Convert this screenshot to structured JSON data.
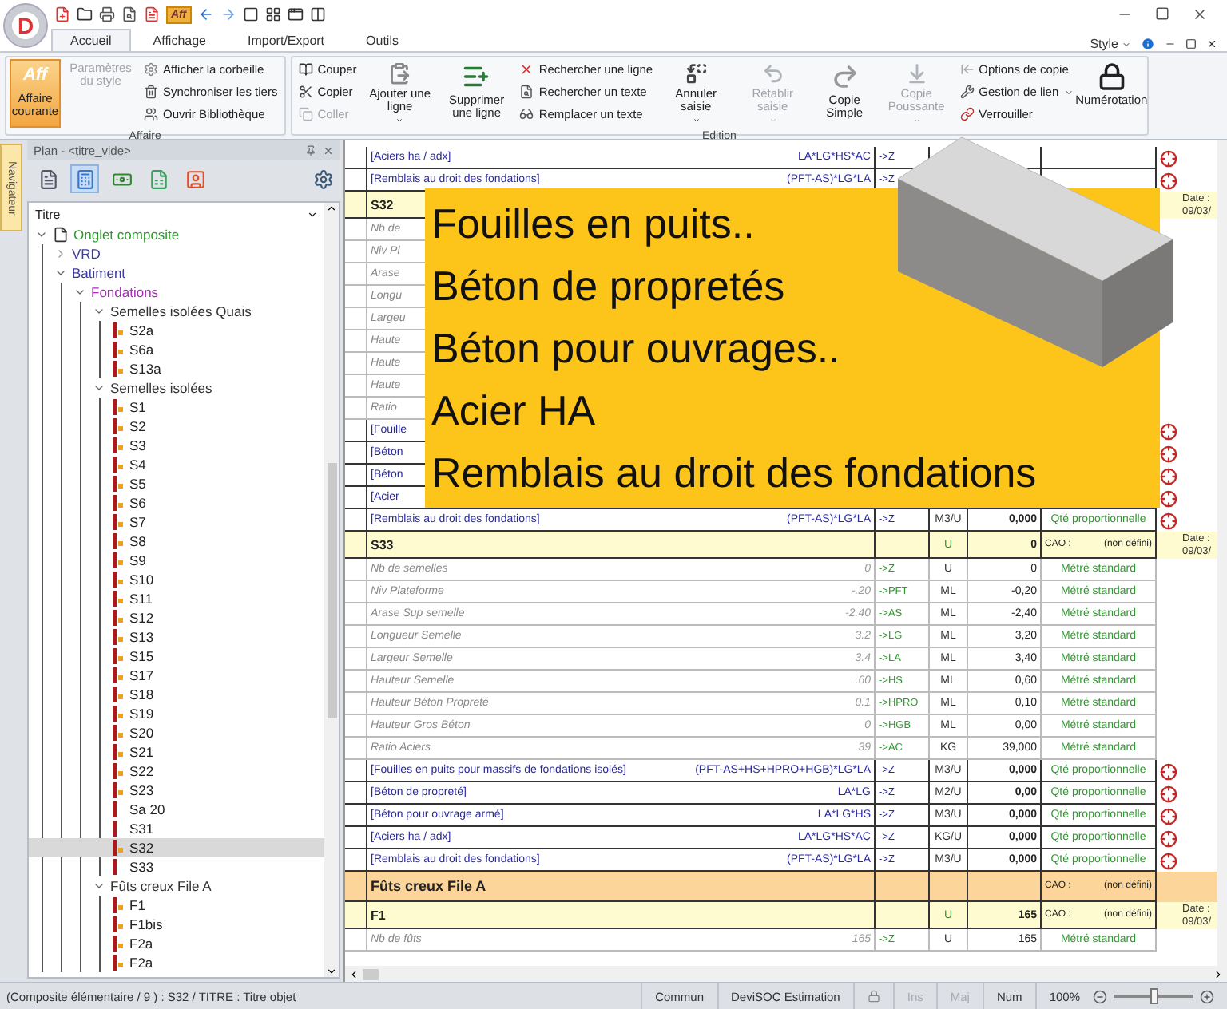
{
  "app_logo": "D",
  "quick_access_label": "Aff",
  "ribbon": {
    "tabs": [
      {
        "label": "Accueil",
        "selected": true
      },
      {
        "label": "Affichage",
        "selected": false
      },
      {
        "label": "Import/Export",
        "selected": false
      },
      {
        "label": "Outils",
        "selected": false
      }
    ],
    "style_menu": "Style",
    "groups": [
      {
        "title": "Affaire",
        "items": [
          {
            "kind": "large",
            "label": "Affaire courante",
            "badge": "Aff",
            "active": true,
            "disabled": false,
            "dropdown": false
          },
          {
            "kind": "large",
            "label": "Paramètres du style",
            "active": false,
            "disabled": true,
            "dropdown": false
          },
          {
            "kind": "stack",
            "buttons": [
              {
                "label": "Afficher la corbeille",
                "disabled": false,
                "dropdown": false
              },
              {
                "label": "Synchroniser les tiers",
                "disabled": false,
                "dropdown": false
              },
              {
                "label": "Ouvrir Bibliothèque",
                "disabled": false,
                "dropdown": false
              }
            ]
          }
        ]
      },
      {
        "title": "Edition",
        "items": [
          {
            "kind": "stack",
            "buttons": [
              {
                "label": "Couper",
                "disabled": false,
                "dropdown": false
              },
              {
                "label": "Copier",
                "disabled": false,
                "dropdown": false
              },
              {
                "label": "Coller",
                "disabled": true,
                "dropdown": false
              }
            ]
          },
          {
            "kind": "large",
            "label": "Ajouter une ligne",
            "active": false,
            "disabled": false,
            "dropdown": true
          },
          {
            "kind": "large",
            "label": "Supprimer une ligne",
            "active": false,
            "disabled": false,
            "dropdown": false
          },
          {
            "kind": "stack",
            "buttons": [
              {
                "label": "Rechercher une ligne",
                "disabled": false,
                "dropdown": false
              },
              {
                "label": "Rechercher un texte",
                "disabled": false,
                "dropdown": false
              },
              {
                "label": "Remplacer un texte",
                "disabled": false,
                "dropdown": false
              }
            ]
          },
          {
            "kind": "large",
            "label": "Annuler saisie",
            "active": false,
            "disabled": false,
            "dropdown": true
          },
          {
            "kind": "large",
            "label": "Rétablir saisie",
            "active": false,
            "disabled": true,
            "dropdown": true
          },
          {
            "kind": "large",
            "label": "Copie Simple",
            "active": false,
            "disabled": false,
            "dropdown": false
          },
          {
            "kind": "large",
            "label": "Copie Poussante",
            "active": false,
            "disabled": true,
            "dropdown": true
          },
          {
            "kind": "stack",
            "buttons": [
              {
                "label": "Options de copie",
                "disabled": false,
                "dropdown": false
              },
              {
                "label": "Gestion de lien",
                "disabled": false,
                "dropdown": true
              },
              {
                "label": "Verrouiller",
                "disabled": false,
                "dropdown": false
              }
            ]
          },
          {
            "kind": "large",
            "label": "Numérotation",
            "active": false,
            "disabled": false,
            "dropdown": false
          }
        ]
      }
    ]
  },
  "navigator": {
    "tab": "Navigateur",
    "title": "Plan - <titre_vide>",
    "toolbar": [
      {
        "selected": false
      },
      {
        "selected": true
      },
      {
        "selected": false
      },
      {
        "selected": false
      },
      {
        "selected": false
      }
    ],
    "tree": {
      "header": "Titre",
      "items": [
        {
          "label": "Onglet composite",
          "kind": "document",
          "color": "#2e9a2e",
          "expanded": true,
          "children": [
            {
              "label": "VRD",
              "kind": "folder",
              "color": "#3a3aa0",
              "expanded": false
            },
            {
              "label": "Batiment",
              "kind": "folder",
              "color": "#3a3aa0",
              "expanded": true,
              "children": [
                {
                  "label": "Fondations",
                  "kind": "folder",
                  "color": "#a030b0",
                  "expanded": true,
                  "children": [
                    {
                      "label": "Semelles isolées Quais",
                      "kind": "folder",
                      "color": "#333333",
                      "expanded": true,
                      "children": [
                        {
                          "label": "S2a",
                          "kind": "leaf",
                          "flagged": true,
                          "selected": false
                        },
                        {
                          "label": "S6a",
                          "kind": "leaf",
                          "flagged": true,
                          "selected": false
                        },
                        {
                          "label": "S13a",
                          "kind": "leaf",
                          "flagged": true,
                          "selected": false
                        }
                      ]
                    },
                    {
                      "label": "Semelles isolées",
                      "kind": "folder",
                      "color": "#333333",
                      "expanded": true,
                      "children": [
                        {
                          "label": "S1",
                          "kind": "leaf",
                          "flagged": true,
                          "selected": false
                        },
                        {
                          "label": "S2",
                          "kind": "leaf",
                          "flagged": true,
                          "selected": false
                        },
                        {
                          "label": "S3",
                          "kind": "leaf",
                          "flagged": true,
                          "selected": false
                        },
                        {
                          "label": "S4",
                          "kind": "leaf",
                          "flagged": true,
                          "selected": false
                        },
                        {
                          "label": "S5",
                          "kind": "leaf",
                          "flagged": true,
                          "selected": false
                        },
                        {
                          "label": "S6",
                          "kind": "leaf",
                          "flagged": true,
                          "selected": false
                        },
                        {
                          "label": "S7",
                          "kind": "leaf",
                          "flagged": true,
                          "selected": false
                        },
                        {
                          "label": "S8",
                          "kind": "leaf",
                          "flagged": true,
                          "selected": false
                        },
                        {
                          "label": "S9",
                          "kind": "leaf",
                          "flagged": true,
                          "selected": false
                        },
                        {
                          "label": "S10",
                          "kind": "leaf",
                          "flagged": true,
                          "selected": false
                        },
                        {
                          "label": "S11",
                          "kind": "leaf",
                          "flagged": true,
                          "selected": false
                        },
                        {
                          "label": "S12",
                          "kind": "leaf",
                          "flagged": true,
                          "selected": false
                        },
                        {
                          "label": "S13",
                          "kind": "leaf",
                          "flagged": true,
                          "selected": false
                        },
                        {
                          "label": "S15",
                          "kind": "leaf",
                          "flagged": true,
                          "selected": false
                        },
                        {
                          "label": "S17",
                          "kind": "leaf",
                          "flagged": true,
                          "selected": false
                        },
                        {
                          "label": "S18",
                          "kind": "leaf",
                          "flagged": true,
                          "selected": false
                        },
                        {
                          "label": "S19",
                          "kind": "leaf",
                          "flagged": true,
                          "selected": false
                        },
                        {
                          "label": "S20",
                          "kind": "leaf",
                          "flagged": true,
                          "selected": false
                        },
                        {
                          "label": "S21",
                          "kind": "leaf",
                          "flagged": true,
                          "selected": false
                        },
                        {
                          "label": "S22",
                          "kind": "leaf",
                          "flagged": true,
                          "selected": false
                        },
                        {
                          "label": "S23",
                          "kind": "leaf",
                          "flagged": true,
                          "selected": false
                        },
                        {
                          "label": "Sa 20",
                          "kind": "leaf",
                          "flagged": false,
                          "selected": false
                        },
                        {
                          "label": "S31",
                          "kind": "leaf",
                          "flagged": false,
                          "selected": false
                        },
                        {
                          "label": "S32",
                          "kind": "leaf",
                          "flagged": true,
                          "selected": true
                        },
                        {
                          "label": "S33",
                          "kind": "leaf",
                          "flagged": false,
                          "selected": false
                        }
                      ]
                    },
                    {
                      "label": "Fûts creux  File A",
                      "kind": "folder",
                      "color": "#333333",
                      "expanded": true,
                      "children": [
                        {
                          "label": "F1",
                          "kind": "leaf",
                          "flagged": true,
                          "selected": false
                        },
                        {
                          "label": "F1bis",
                          "kind": "leaf",
                          "flagged": true,
                          "selected": false
                        },
                        {
                          "label": "F2a",
                          "kind": "leaf",
                          "flagged": true,
                          "selected": false
                        },
                        {
                          "label": "F2a",
                          "kind": "leaf",
                          "flagged": true,
                          "selected": false
                        }
                      ]
                    }
                  ]
                }
              ]
            }
          ]
        }
      ]
    }
  },
  "table": {
    "rows": [
      {
        "kind": "formula",
        "label": "[Aciers ha / adx]",
        "formula": "LA*LG*HS*AC",
        "var": "->Z",
        "marker": true
      },
      {
        "kind": "formula",
        "label": "[Remblais au droit des fondations]",
        "formula": "(PFT-AS)*LG*LA",
        "var": "->Z",
        "marker": true
      },
      {
        "kind": "item",
        "label": "S32",
        "note": [
          "Date :",
          "09/03/"
        ]
      },
      {
        "kind": "measure",
        "label": "Nb de"
      },
      {
        "kind": "measure",
        "label": "Niv Pl"
      },
      {
        "kind": "measure",
        "label": "Arase"
      },
      {
        "kind": "measure",
        "label": "Longu"
      },
      {
        "kind": "measure",
        "label": "Largeu"
      },
      {
        "kind": "measure",
        "label": "Haute"
      },
      {
        "kind": "measure",
        "label": "Haute"
      },
      {
        "kind": "measure",
        "label": "Haute"
      },
      {
        "kind": "measure",
        "label": "Ratio"
      },
      {
        "kind": "formula",
        "label": "[Fouille",
        "marker": true
      },
      {
        "kind": "formula",
        "label": "[Béton",
        "marker": true
      },
      {
        "kind": "formula",
        "label": "[Béton",
        "marker": true
      },
      {
        "kind": "formula",
        "label": "[Acier",
        "marker": true
      },
      {
        "kind": "formula",
        "label": "[Remblais au droit des fondations]",
        "formula": "(PFT-AS)*LG*LA",
        "var": "->Z",
        "unit": "M3/U",
        "qty": "0,000",
        "type": "Qté proportionnelle",
        "marker": true
      },
      {
        "kind": "item",
        "label": "S33",
        "unit": "U",
        "qty": "0",
        "cao": "CAO :",
        "cao_value": "(non défini)",
        "note": [
          "Date :",
          "09/03/"
        ]
      },
      {
        "kind": "measure",
        "label": "Nb de semelles",
        "formula": "0",
        "var": "->Z",
        "unit": "U",
        "qty": "0",
        "type": "Métré standard"
      },
      {
        "kind": "measure",
        "label": "Niv Plateforme",
        "formula": "-.20",
        "var": "->PFT",
        "unit": "ML",
        "qty": "-0,20",
        "type": "Métré standard"
      },
      {
        "kind": "measure",
        "label": "Arase Sup semelle",
        "formula": "-2.40",
        "var": "->AS",
        "unit": "ML",
        "qty": "-2,40",
        "type": "Métré standard"
      },
      {
        "kind": "measure",
        "label": "Longueur Semelle",
        "formula": "3.2",
        "var": "->LG",
        "unit": "ML",
        "qty": "3,20",
        "type": "Métré standard"
      },
      {
        "kind": "measure",
        "label": "Largeur Semelle",
        "formula": "3.4",
        "var": "->LA",
        "unit": "ML",
        "qty": "3,40",
        "type": "Métré standard"
      },
      {
        "kind": "measure",
        "label": "Hauteur Semelle",
        "formula": ".60",
        "var": "->HS",
        "unit": "ML",
        "qty": "0,60",
        "type": "Métré standard"
      },
      {
        "kind": "measure",
        "label": "Hauteur Béton Propreté",
        "formula": "0.1",
        "var": "->HPRO",
        "unit": "ML",
        "qty": "0,10",
        "type": "Métré standard"
      },
      {
        "kind": "measure",
        "label": "Hauteur Gros Béton",
        "formula": "0",
        "var": "->HGB",
        "unit": "ML",
        "qty": "0,00",
        "type": "Métré standard"
      },
      {
        "kind": "measure",
        "label": "Ratio Aciers",
        "formula": "39",
        "var": "->AC",
        "unit": "KG",
        "qty": "39,000",
        "type": "Métré standard"
      },
      {
        "kind": "formula",
        "label": "[Fouilles en puits pour massifs de fondations isolés]",
        "formula": "(PFT-AS+HS+HPRO+HGB)*LG*LA",
        "var": "->Z",
        "unit": "M3/U",
        "qty": "0,000",
        "type": "Qté proportionnelle",
        "marker": true
      },
      {
        "kind": "formula",
        "label": "[Béton de propreté]",
        "formula": "LA*LG",
        "var": "->Z",
        "unit": "M2/U",
        "qty": "0,00",
        "type": "Qté proportionnelle",
        "marker": true
      },
      {
        "kind": "formula",
        "label": "[Béton pour ouvrage armé]",
        "formula": "LA*LG*HS",
        "var": "->Z",
        "unit": "M3/U",
        "qty": "0,000",
        "type": "Qté proportionnelle",
        "marker": true
      },
      {
        "kind": "formula",
        "label": "[Aciers ha / adx]",
        "formula": "LA*LG*HS*AC",
        "var": "->Z",
        "unit": "KG/U",
        "qty": "0,000",
        "type": "Qté proportionnelle",
        "marker": true
      },
      {
        "kind": "formula",
        "label": "[Remblais au droit des fondations]",
        "formula": "(PFT-AS)*LG*LA",
        "var": "->Z",
        "unit": "M3/U",
        "qty": "0,000",
        "type": "Qté proportionnelle",
        "marker": true
      },
      {
        "kind": "group",
        "label": "Fûts creux  File A",
        "cao": "CAO :",
        "cao_value": "(non défini)"
      },
      {
        "kind": "item",
        "label": "F1",
        "unit": "U",
        "qty": "165",
        "cao": "CAO :",
        "cao_value": "(non défini)",
        "note": [
          "Date :",
          "09/03/"
        ]
      },
      {
        "kind": "measure",
        "label": "Nb de fûts",
        "formula": "165",
        "var": "->Z",
        "unit": "U",
        "qty": "165",
        "type": "Métré standard"
      }
    ]
  },
  "overlay": {
    "lines": [
      "Fouilles en puits..",
      "Béton de propretés",
      "Béton pour ouvrages..",
      "Acier HA",
      "Remblais au droit des fondations"
    ]
  },
  "status_bar": {
    "text": "(Composite élémentaire / 9 ) : S32 / TITRE : Titre objet",
    "panels": [
      "Commun",
      "DeviSOC Estimation"
    ],
    "keys": [
      {
        "label": "Ins",
        "on": false
      },
      {
        "label": "Maj",
        "on": false
      },
      {
        "label": "Num",
        "on": true
      }
    ],
    "zoom": "100%",
    "zoom_slider": {
      "level": 0.5
    }
  }
}
